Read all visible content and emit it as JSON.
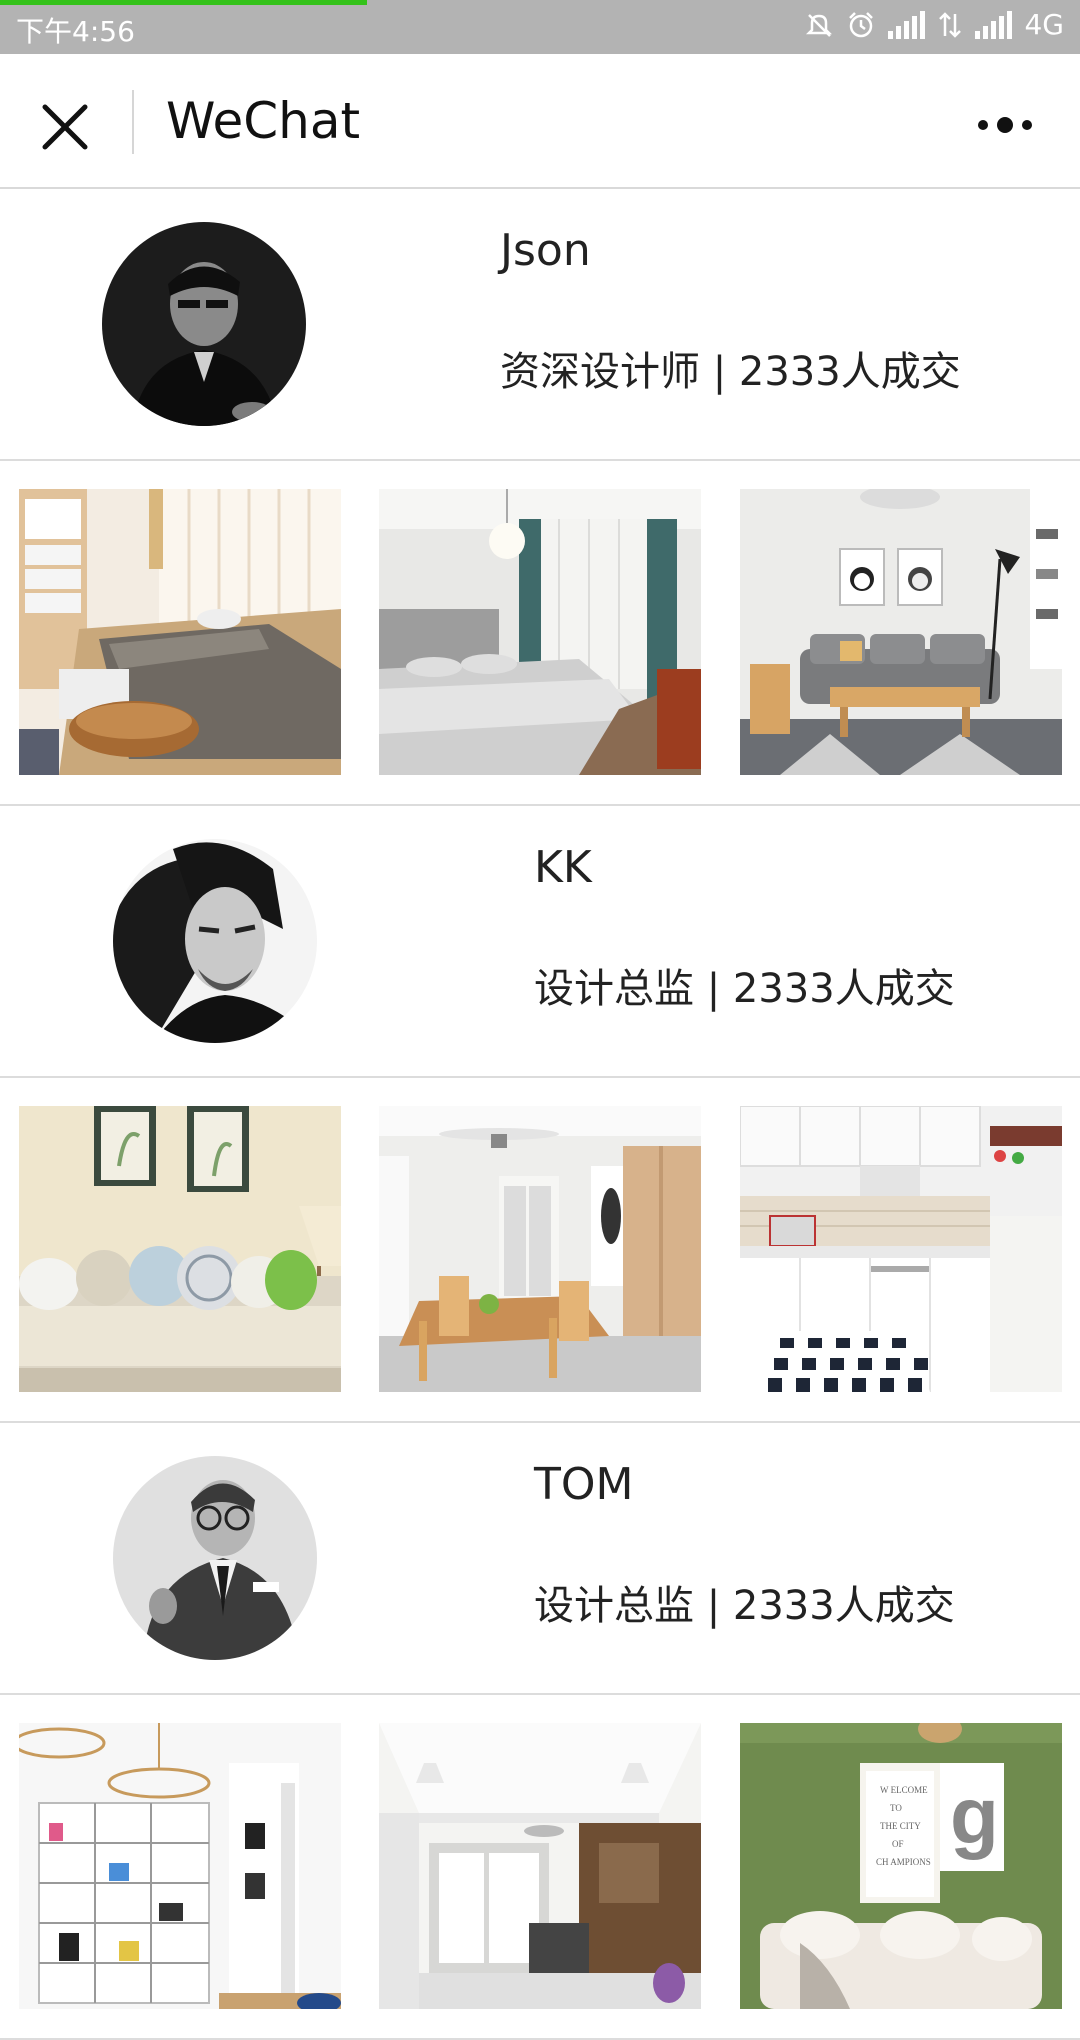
{
  "status_bar": {
    "time": "下午4:56",
    "network": "4G",
    "page_load_progress": 0.34,
    "colors": {
      "background": "#b3b3b3",
      "progress": "#34c21a"
    }
  },
  "nav": {
    "title": "WeChat",
    "close_icon": "close-icon",
    "more_icon": "more-icon"
  },
  "designers": [
    {
      "name": "Json",
      "meta": "资深设计师 | 2333人成交",
      "photos": [
        "tatami-room-photo",
        "gray-bedroom-photo",
        "panda-living-room-photo"
      ]
    },
    {
      "name": "KK",
      "meta": "设计总监 | 2333人成交",
      "photos": [
        "sofa-pillows-photo",
        "dining-room-photo",
        "white-kitchen-photo"
      ]
    },
    {
      "name": "TOM",
      "meta": "设计总监 | 2333人成交",
      "photos": [
        "bookshelf-study-photo",
        "bright-living-room-photo",
        "green-wall-living-room-photo"
      ]
    }
  ]
}
